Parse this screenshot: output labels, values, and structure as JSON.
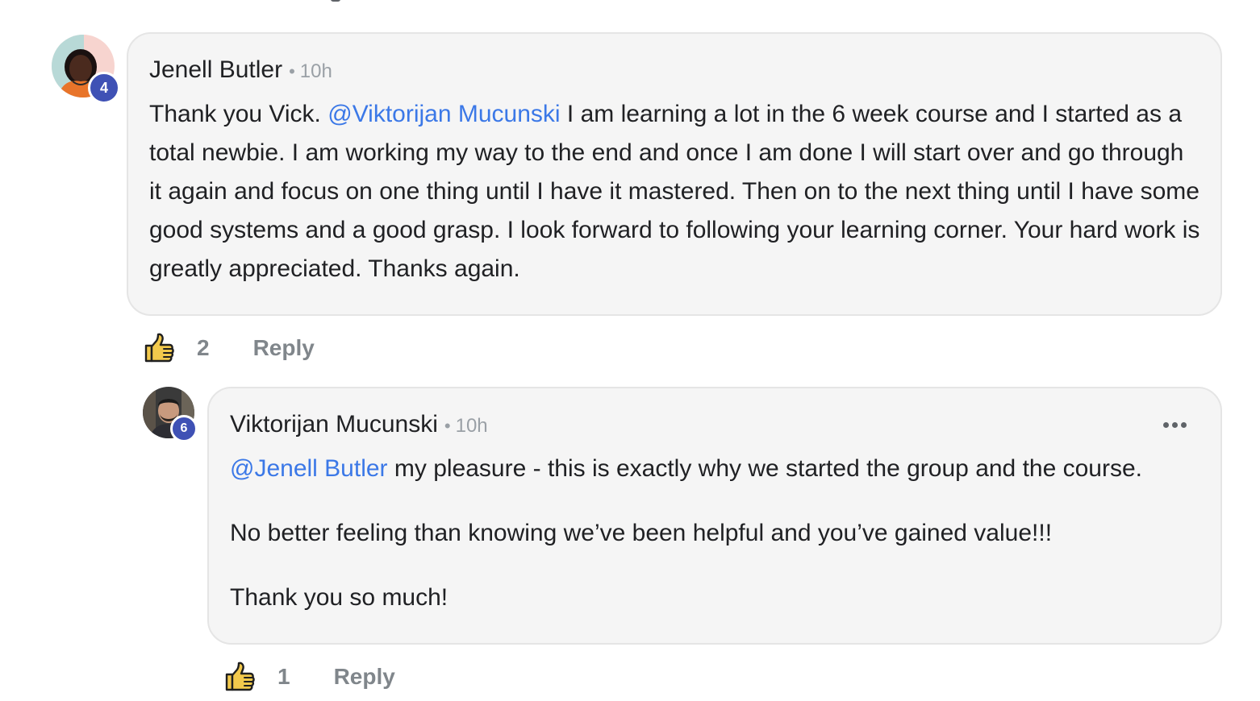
{
  "comments": [
    {
      "author": "Jenell Butler",
      "separator": "•",
      "time": "10h",
      "level": "4",
      "avatar_icon": "user-avatar-icon",
      "body_segments": [
        {
          "type": "text",
          "text": "Thank you Vick. "
        },
        {
          "type": "mention",
          "text": "@Viktorijan Mucunski"
        },
        {
          "type": "text",
          "text": " I am learning a lot in the 6 week course and I started as a total newbie. I am working my way to the end and once I am done I will start over and go through it again and focus on one thing until I have it mastered. Then on to the next thing until I have some good systems and a good grasp. I look forward to following your learning corner. Your hard work is greatly appreciated. Thanks again."
        }
      ],
      "likes": "2",
      "reply_label": "Reply",
      "like_icon": "thumbs-up-icon"
    },
    {
      "author": "Viktorijan Mucunski",
      "separator": "•",
      "time": "10h",
      "level": "6",
      "avatar_icon": "user-avatar-icon",
      "more_icon": "more-options-icon",
      "mention": "@Jenell Butler",
      "line1_rest": " my pleasure - this is exactly why we started the group and the course.",
      "line2": "No better feeling than knowing we’ve been helpful and you’ve gained value!!!",
      "line3": "Thank you so much!",
      "likes": "1",
      "reply_label": "Reply",
      "like_icon": "thumbs-up-icon"
    }
  ],
  "colors": {
    "mention": "#3b78e7",
    "level_badge": "#3f51b5",
    "bubble_bg": "#f5f5f5",
    "muted_text": "#80868b",
    "like_icon_fill": "#f2c94c"
  }
}
